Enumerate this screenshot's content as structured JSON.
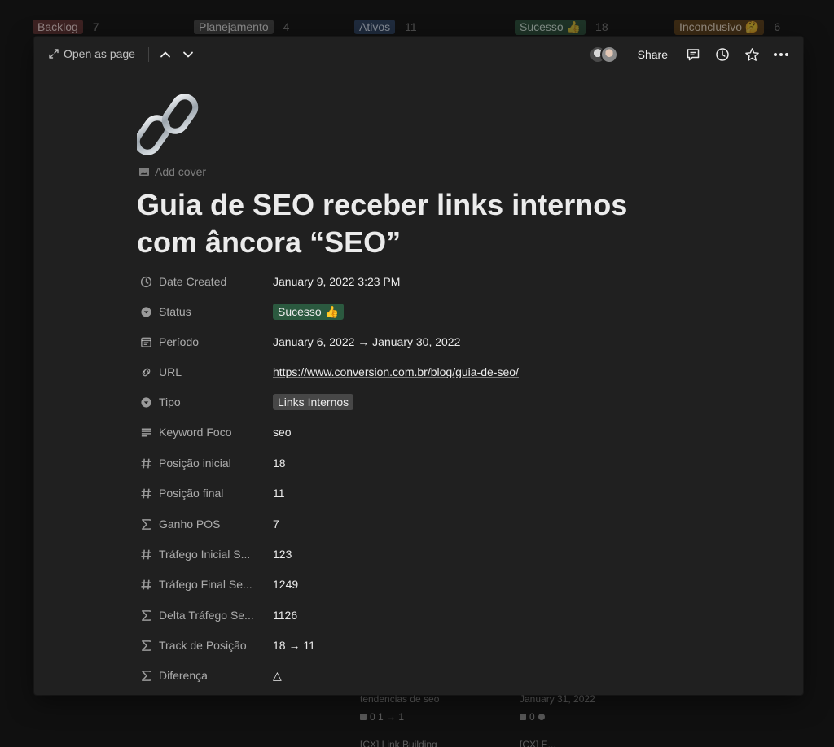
{
  "board": {
    "columns": [
      {
        "label": "Backlog",
        "count": "7",
        "color": "#3d2222"
      },
      {
        "label": "Planejamento",
        "count": "4",
        "color": "#2d2d2d"
      },
      {
        "label": "Ativos",
        "count": "11",
        "color": "#1f2b3d"
      },
      {
        "label": "Sucesso 👍",
        "count": "18",
        "color": "#1e3327"
      },
      {
        "label": "Inconclusivo 🤔",
        "count": "6",
        "color": "#3b2a14"
      }
    ],
    "cards": [
      {
        "title": "tendencias de seo",
        "meta": "0  1 → 1"
      },
      {
        "title": "January 31, 2022",
        "meta": "0"
      },
      {
        "title": "[CX] Link Building",
        "meta": ""
      },
      {
        "title": "[CX] E...",
        "meta": ""
      }
    ]
  },
  "topbar": {
    "open_as_page": "Open as page",
    "share": "Share"
  },
  "page": {
    "icon": "link-icon",
    "add_cover": "Add cover",
    "title": "Guia de SEO receber links internos com âncora “SEO”"
  },
  "properties": [
    {
      "icon": "clock-icon",
      "name": "Date Created",
      "value": "January 9, 2022 3:23 PM",
      "kind": "text"
    },
    {
      "icon": "select-icon",
      "name": "Status",
      "value": "Sucesso 👍",
      "kind": "tag-green"
    },
    {
      "icon": "calendar-icon",
      "name": "Período",
      "value": "January 6, 2022 → January 30, 2022",
      "kind": "text"
    },
    {
      "icon": "url-icon",
      "name": "URL",
      "value": "https://www.conversion.com.br/blog/guia-de-seo/",
      "kind": "link"
    },
    {
      "icon": "select-icon",
      "name": "Tipo",
      "value": "Links Internos",
      "kind": "tag-gray"
    },
    {
      "icon": "text-icon",
      "name": "Keyword Foco",
      "value": "seo",
      "kind": "text"
    },
    {
      "icon": "number-icon",
      "name": "Posição inicial",
      "value": "18",
      "kind": "text"
    },
    {
      "icon": "number-icon",
      "name": "Posição final",
      "value": "11",
      "kind": "text"
    },
    {
      "icon": "formula-icon",
      "name": "Ganho POS",
      "value": "7",
      "kind": "text"
    },
    {
      "icon": "number-icon",
      "name": "Tráfego Inicial S...",
      "value": "123",
      "kind": "text"
    },
    {
      "icon": "number-icon",
      "name": "Tráfego Final Se...",
      "value": "1249",
      "kind": "text"
    },
    {
      "icon": "formula-icon",
      "name": "Delta Tráfego Se...",
      "value": "1126",
      "kind": "text"
    },
    {
      "icon": "formula-icon",
      "name": "Track de Posição",
      "value": "18 → 11",
      "kind": "text"
    },
    {
      "icon": "formula-icon",
      "name": "Diferença",
      "value": "△",
      "kind": "text"
    }
  ]
}
